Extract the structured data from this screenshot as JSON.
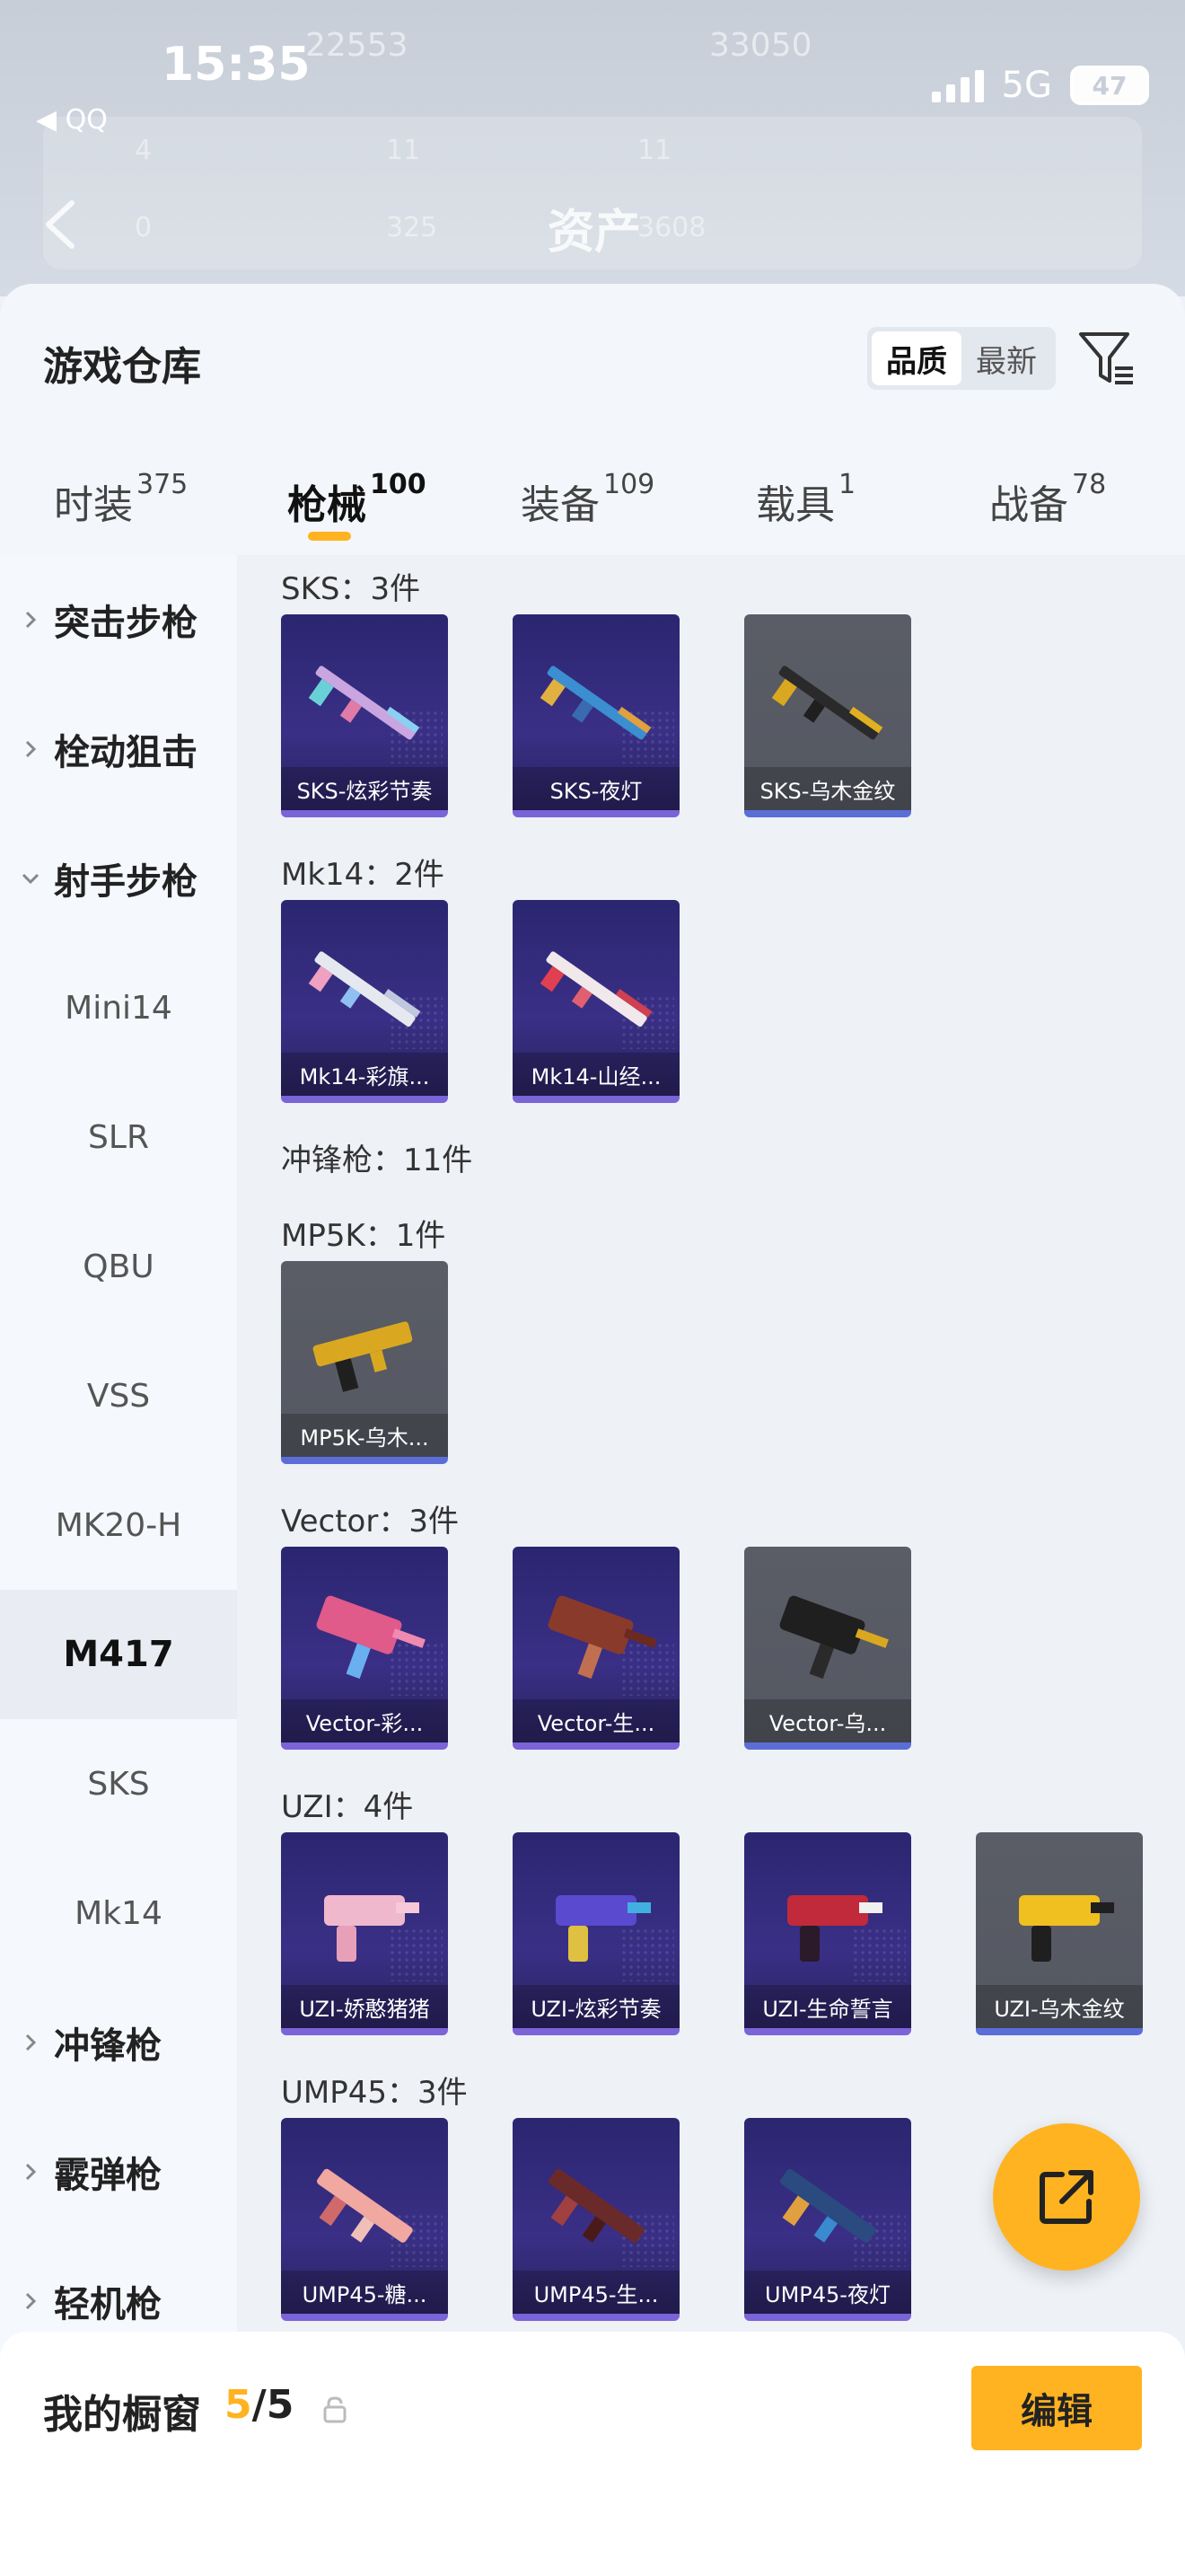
{
  "status_bar": {
    "time": "15:35",
    "network": "5G",
    "battery": "47",
    "back_app": "◀ QQ"
  },
  "background": {
    "title": "资产",
    "numbers": [
      "22553",
      "33050",
      "4",
      "11",
      "11",
      "0",
      "325",
      "3608"
    ]
  },
  "sheet": {
    "title": "游戏仓库",
    "sort": {
      "options": [
        "品质",
        "最新"
      ],
      "active": "品质"
    }
  },
  "tabs": [
    {
      "label": "时装",
      "count": "375"
    },
    {
      "label": "枪械",
      "count": "100",
      "active": true
    },
    {
      "label": "装备",
      "count": "109"
    },
    {
      "label": "载具",
      "count": "1"
    },
    {
      "label": "战备",
      "count": "78"
    }
  ],
  "sidebar": {
    "items": [
      {
        "label": "突击步枪",
        "type": "category",
        "expanded": false
      },
      {
        "label": "栓动狙击",
        "type": "category",
        "expanded": false
      },
      {
        "label": "射手步枪",
        "type": "category",
        "expanded": true
      },
      {
        "label": "Mini14",
        "type": "sub"
      },
      {
        "label": "SLR",
        "type": "sub"
      },
      {
        "label": "QBU",
        "type": "sub"
      },
      {
        "label": "VSS",
        "type": "sub"
      },
      {
        "label": "MK20-H",
        "type": "sub"
      },
      {
        "label": "M417",
        "type": "sub",
        "active": true
      },
      {
        "label": "SKS",
        "type": "sub"
      },
      {
        "label": "Mk14",
        "type": "sub"
      },
      {
        "label": "冲锋枪",
        "type": "category",
        "expanded": false
      },
      {
        "label": "霰弹枪",
        "type": "category",
        "expanded": false
      },
      {
        "label": "轻机枪",
        "type": "category",
        "expanded": false
      }
    ]
  },
  "sections": {
    "sks": {
      "label": "SKS：3件",
      "items": [
        {
          "name": "SKS-炫彩节奏",
          "rarity": "purple"
        },
        {
          "name": "SKS-夜灯",
          "rarity": "purple"
        },
        {
          "name": "SKS-乌木金纹",
          "rarity": "gray"
        }
      ]
    },
    "mk14": {
      "label": "Mk14：2件",
      "items": [
        {
          "name": "Mk14-彩旗...",
          "rarity": "purple"
        },
        {
          "name": "Mk14-山经...",
          "rarity": "purple"
        }
      ]
    },
    "smg": {
      "label": "冲锋枪：11件"
    },
    "mp5k": {
      "label": "MP5K：1件",
      "items": [
        {
          "name": "MP5K-乌木...",
          "rarity": "gray"
        }
      ]
    },
    "vector": {
      "label": "Vector：3件",
      "items": [
        {
          "name": "Vector-彩...",
          "rarity": "purple"
        },
        {
          "name": "Vector-生...",
          "rarity": "purple"
        },
        {
          "name": "Vector-乌...",
          "rarity": "gray"
        }
      ]
    },
    "uzi": {
      "label": "UZI：4件",
      "items": [
        {
          "name": "UZI-娇憨猪猪",
          "rarity": "purple"
        },
        {
          "name": "UZI-炫彩节奏",
          "rarity": "purple"
        },
        {
          "name": "UZI-生命誓言",
          "rarity": "purple"
        },
        {
          "name": "UZI-乌木金纹",
          "rarity": "gray"
        }
      ]
    },
    "ump45": {
      "label": "UMP45：3件",
      "items": [
        {
          "name": "UMP45-糖...",
          "rarity": "purple"
        },
        {
          "name": "UMP45-生...",
          "rarity": "purple"
        },
        {
          "name": "UMP45-夜灯",
          "rarity": "purple"
        }
      ]
    }
  },
  "showcase": {
    "label": "我的橱窗",
    "count_current": "5",
    "count_sep": "/",
    "count_total": "5",
    "edit_label": "编辑"
  },
  "colors": {
    "accent": "#ffb320",
    "purple_card": "#2b2670",
    "gray_card": "#5a5d66"
  },
  "icons": [
    "signal-icon",
    "battery-icon",
    "back-arrow-icon",
    "filter-icon",
    "chevron-right-icon",
    "chevron-down-icon",
    "share-icon",
    "lock-icon"
  ]
}
